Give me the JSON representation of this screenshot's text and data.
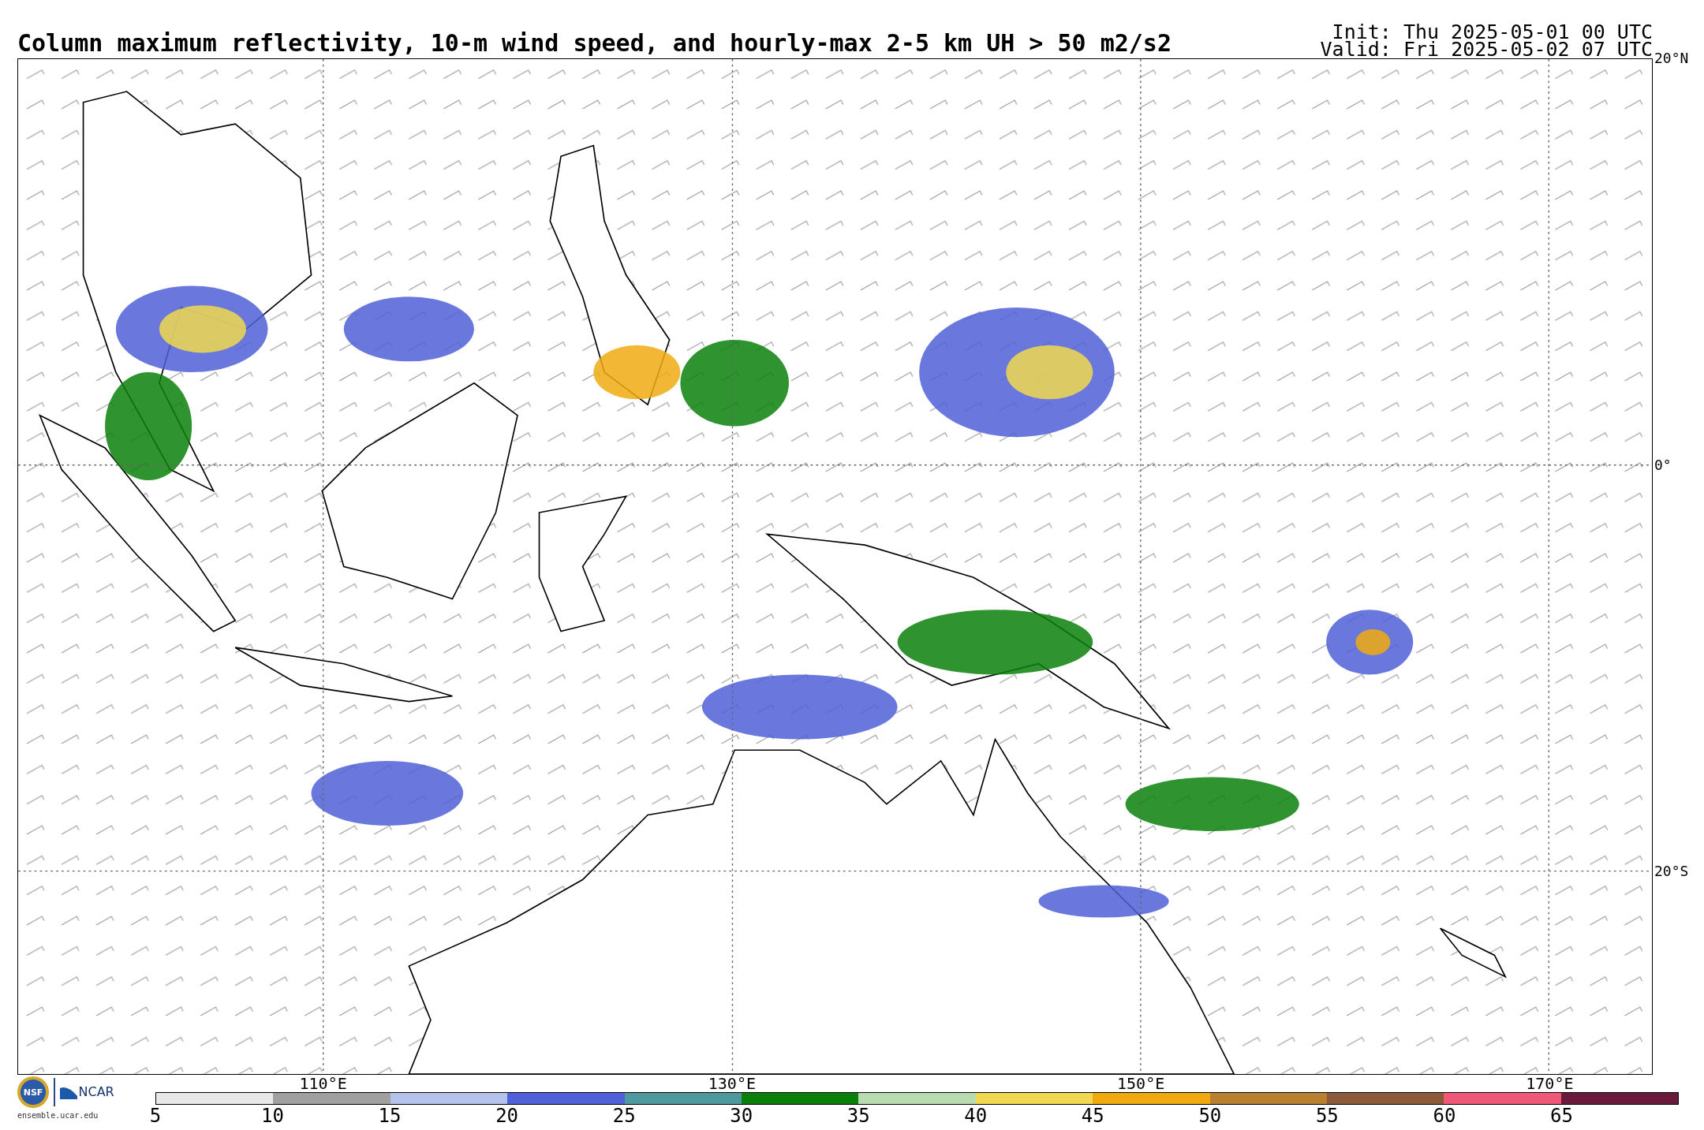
{
  "title": "Column maximum reflectivity, 10-m wind speed, and hourly-max 2-5 km UH > 50 m2/s2",
  "init": "Init: Thu 2025-05-01 00 UTC",
  "valid": "Valid: Fri 2025-05-02 07 UTC",
  "map": {
    "lat_labels": [
      "20°N",
      "0°",
      "20°S"
    ],
    "lon_labels": [
      "110°E",
      "130°E",
      "150°E",
      "170°E"
    ]
  },
  "logos": {
    "nsf": "NSF",
    "ncar": "NCAR",
    "site": "ensemble.ucar.edu"
  },
  "colorbar": {
    "segments": [
      {
        "color": "#e8e8e8"
      },
      {
        "color": "#a0a0a0"
      },
      {
        "color": "#b4c3ec"
      },
      {
        "color": "#5060d8"
      },
      {
        "color": "#4e9a9e"
      },
      {
        "color": "#0a800a"
      },
      {
        "color": "#b8dcb0"
      },
      {
        "color": "#f0d850"
      },
      {
        "color": "#f0aa10"
      },
      {
        "color": "#b88030"
      },
      {
        "color": "#8a5a3a"
      },
      {
        "color": "#f05878"
      },
      {
        "color": "#6a1a3a"
      }
    ],
    "ticks": [
      "5",
      "10",
      "15",
      "20",
      "25",
      "30",
      "35",
      "40",
      "45",
      "50",
      "55",
      "60",
      "65"
    ]
  }
}
